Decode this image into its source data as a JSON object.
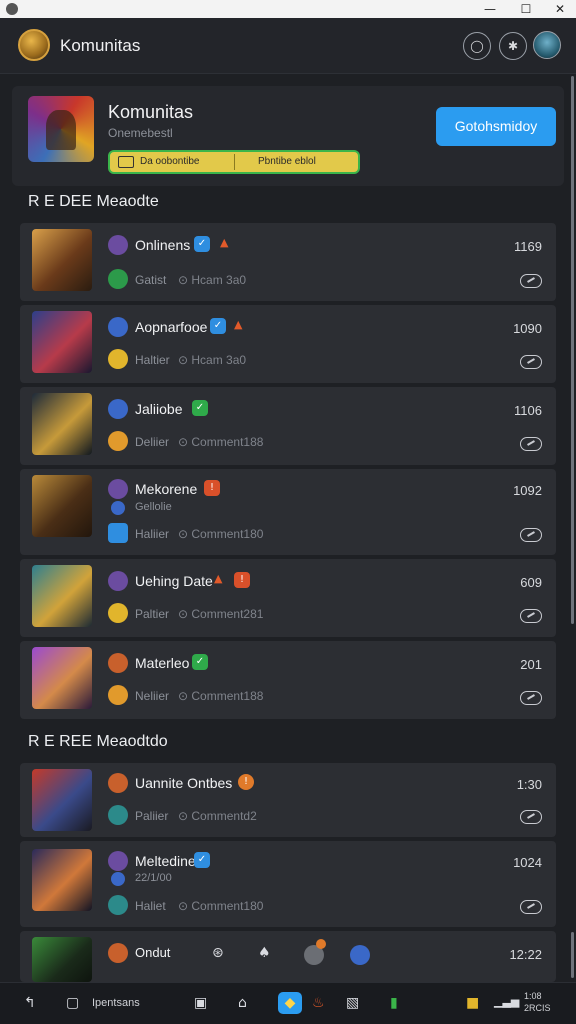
{
  "window": {
    "minimize": "—",
    "maximize": "☐",
    "close": "✕"
  },
  "header": {
    "title": "Komunitas",
    "icons": [
      "chat-icon",
      "settings-icon"
    ]
  },
  "profile": {
    "title": "Komunitas",
    "subtitle": "Onemebestl",
    "banner_left": "Da oobontibe",
    "banner_right": "Pbntibe eblol",
    "join_button": "Gotohsmidoy"
  },
  "sections": [
    {
      "title": "R E DEE Meaodte"
    },
    {
      "title": "R E REE Meaodtdo"
    }
  ],
  "rows": [
    {
      "title": "Onlinens",
      "count": "1169",
      "line1": "Gatist",
      "line1_meta": "Hcam 3a0",
      "line2": ""
    },
    {
      "title": "Aopnarfooe",
      "count": "1090",
      "line1": "Haltier",
      "line1_meta": "Hcam 3a0",
      "line2": ""
    },
    {
      "title": "Jaliiobe",
      "count": "1106",
      "line1": "Deliier",
      "line1_meta": "Comment188",
      "line2": ""
    },
    {
      "title": "Mekorene",
      "count": "1092",
      "line1": "Gellolie",
      "line1_meta": "",
      "line2": "Haliier",
      "line2_meta": "Comment180"
    },
    {
      "title": "Uehing Date",
      "count": "609",
      "line1": "Paltier",
      "line1_meta": "Comment281",
      "line2": ""
    },
    {
      "title": "Materleo",
      "count": "201",
      "line1": "Neliier",
      "line1_meta": "Comment188",
      "line2": ""
    },
    {
      "title": "Uannite Ontbes",
      "count": "1:30",
      "line1": "Paliier",
      "line1_meta": "Commentd2",
      "line2": ""
    },
    {
      "title": "Meltedine",
      "count": "1024",
      "line1": "22/1/00",
      "line1_meta": "",
      "line2": "Haliet",
      "line2_meta": "Comment180"
    },
    {
      "title": "Ondut",
      "count": "12:22",
      "line1": "",
      "line1_meta": "",
      "line2": ""
    }
  ],
  "taskbar": {
    "label": "Ipentsans",
    "clock_line1": "1:08",
    "clock_line2": "2RCIS"
  },
  "colors": {
    "accent": "#2b9cf0",
    "background": "#1e2024",
    "row": "#2c2e33",
    "banner": "#e2c94a",
    "banner_border": "#3bb54a"
  }
}
